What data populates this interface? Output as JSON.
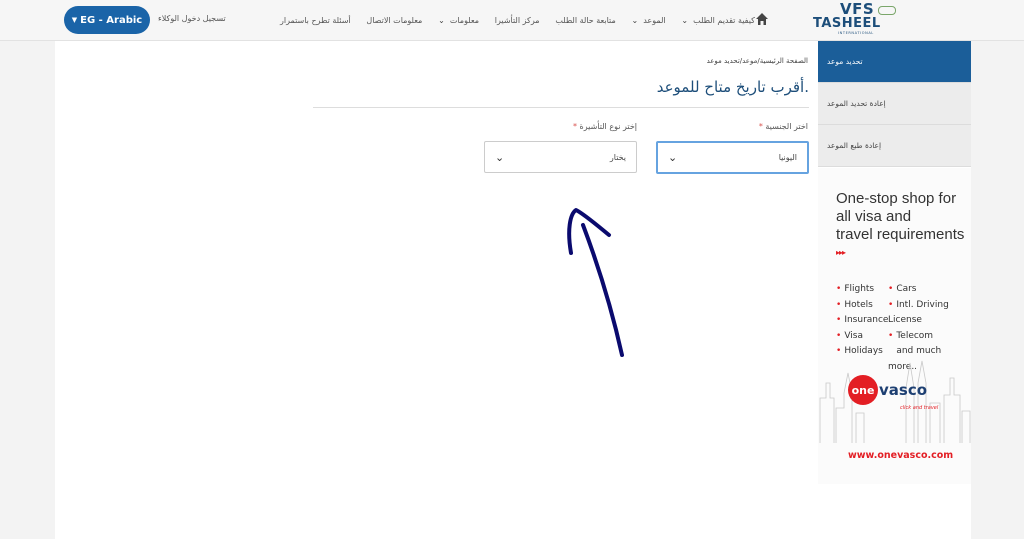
{
  "header": {
    "language_button": "EG - Arabic",
    "agent_login": "تسجيل دخول الوكلاء",
    "nav": [
      {
        "label": "كيفية تقديم الطلب",
        "dropdown": true
      },
      {
        "label": "الموعد",
        "dropdown": true
      },
      {
        "label": "متابعة حالة الطلب",
        "dropdown": false
      },
      {
        "label": "مركز التأشيرا",
        "dropdown": false
      },
      {
        "label": "معلومات",
        "dropdown": true
      },
      {
        "label": "معلومات الاتصال",
        "dropdown": false
      },
      {
        "label": "أسئلة تطرح باستمرار",
        "dropdown": false
      }
    ],
    "home_icon": "home-icon",
    "logo": {
      "line1": "VFS",
      "line2": "TASHEEL",
      "line3": "INTERNATIONAL"
    }
  },
  "main": {
    "breadcrumb": "الصفحة الرئيسية/موعد/تحديد موعد",
    "title": "أقرب تاريخ متاح للموعد.",
    "nationality_label": "اختر الجنسية",
    "nationality_value": "اليونيا",
    "visa_type_label": "إختر نوع التأشيرة",
    "visa_type_value": "يختار",
    "required_mark": "*"
  },
  "sidebar": {
    "items": [
      {
        "label": "تحديد موعد",
        "active": true
      },
      {
        "label": "إعادة تحديد الموعد",
        "active": false
      },
      {
        "label": "إعادة طبع الموعد",
        "active": false
      }
    ]
  },
  "ad": {
    "headline": [
      "One-stop shop for",
      "all visa and",
      "travel requirements"
    ],
    "arrows": "▸▸▸",
    "col1": [
      "Flights",
      "Hotels",
      "Insurance",
      "Visa",
      "Holidays"
    ],
    "col2": [
      "Cars",
      "Intl. Driving License",
      "Telecom",
      "and much more.."
    ],
    "brand_circle": "one",
    "brand_rest": "vasco",
    "tagline": "click and travel",
    "url": "www.onevasco.com"
  },
  "colors": {
    "brand_blue": "#1b5e99",
    "button_blue": "#1a64a8",
    "accent_red": "#e31e24",
    "annotation_ink": "#0a0a6e"
  }
}
